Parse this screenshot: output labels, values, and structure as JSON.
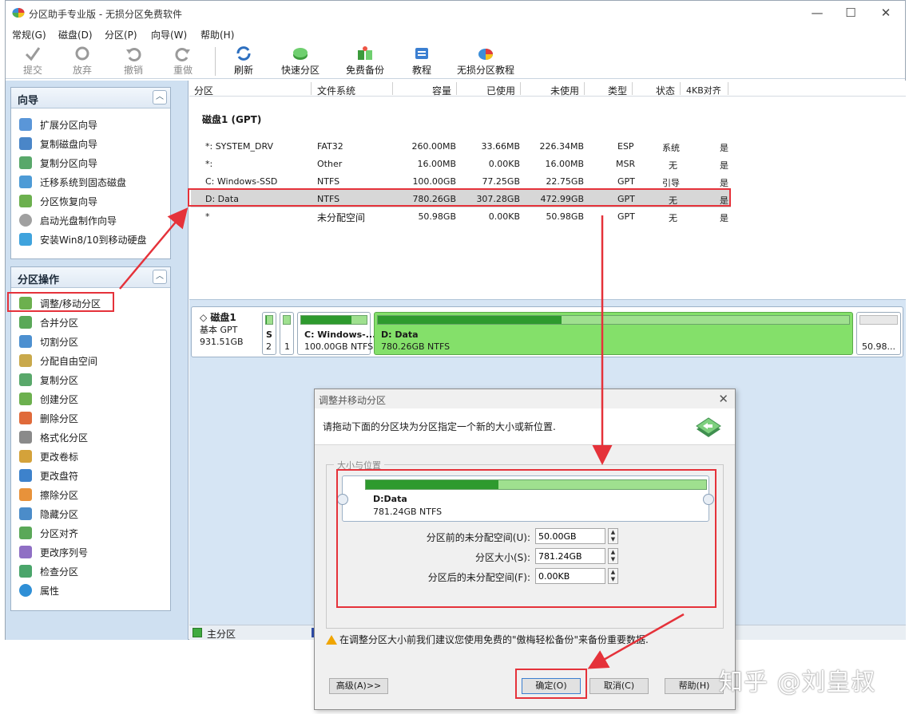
{
  "app": {
    "title": "分区助手专业版 - 无损分区免费软件",
    "min": "—",
    "max": "☐",
    "close": "✕"
  },
  "menu": [
    "常规(G)",
    "磁盘(D)",
    "分区(P)",
    "向导(W)",
    "帮助(H)"
  ],
  "toolbar": [
    {
      "label": "提交",
      "icon": "check-icon",
      "enabled": false
    },
    {
      "label": "放弃",
      "icon": "discard-icon",
      "enabled": false
    },
    {
      "label": "撤销",
      "icon": "undo-icon",
      "enabled": false
    },
    {
      "label": "重做",
      "icon": "redo-icon",
      "enabled": false
    },
    {
      "label": "刷新",
      "icon": "refresh-icon",
      "enabled": true
    },
    {
      "label": "快速分区",
      "icon": "quick-partition-icon",
      "enabled": true
    },
    {
      "label": "免费备份",
      "icon": "backup-icon",
      "enabled": true
    },
    {
      "label": "教程",
      "icon": "tutorial-icon",
      "enabled": true
    },
    {
      "label": "无损分区教程",
      "icon": "lossless-tutorial-icon",
      "enabled": true
    }
  ],
  "wizard_panel": {
    "title": "向导",
    "items": [
      "扩展分区向导",
      "复制磁盘向导",
      "复制分区向导",
      "迁移系统到固态磁盘",
      "分区恢复向导",
      "启动光盘制作向导",
      "安装Win8/10到移动硬盘"
    ]
  },
  "ops_panel": {
    "title": "分区操作",
    "items": [
      "调整/移动分区",
      "合并分区",
      "切割分区",
      "分配自由空间",
      "复制分区",
      "创建分区",
      "删除分区",
      "格式化分区",
      "更改卷标",
      "更改盘符",
      "擦除分区",
      "隐藏分区",
      "分区对齐",
      "更改序列号",
      "检查分区",
      "属性"
    ]
  },
  "table": {
    "headers": [
      "分区",
      "文件系统",
      "容量",
      "已使用",
      "未使用",
      "类型",
      "状态",
      "4KB对齐"
    ],
    "disk_label": "磁盘1 (GPT)",
    "rows": [
      [
        "*: SYSTEM_DRV",
        "FAT32",
        "260.00MB",
        "33.66MB",
        "226.34MB",
        "ESP",
        "系统",
        "是"
      ],
      [
        "*:",
        "Other",
        "16.00MB",
        "0.00KB",
        "16.00MB",
        "MSR",
        "无",
        "是"
      ],
      [
        "C: Windows-SSD",
        "NTFS",
        "100.00GB",
        "77.25GB",
        "22.75GB",
        "GPT",
        "引导",
        "是"
      ],
      [
        "D: Data",
        "NTFS",
        "780.26GB",
        "307.28GB",
        "472.99GB",
        "GPT",
        "无",
        "是"
      ],
      [
        "*",
        "未分配空间",
        "50.98GB",
        "0.00KB",
        "50.98GB",
        "GPT",
        "无",
        "是"
      ]
    ],
    "selected_row": 3
  },
  "disk_map": {
    "name": "磁盘1",
    "style": "基本 GPT",
    "size": "931.51GB",
    "parts": [
      {
        "name": "S",
        "info": "2",
        "used": 0.13
      },
      {
        "name": "",
        "info": "1",
        "used": 0.0
      },
      {
        "name": "C: Windows-...",
        "info": "100.00GB NTFS",
        "used": 0.77
      },
      {
        "name": "D: Data",
        "info": "780.26GB NTFS",
        "used": 0.39
      },
      {
        "name": "",
        "info": "50.98...",
        "used": 0.0
      }
    ]
  },
  "legend": {
    "primary": "主分区"
  },
  "dialog": {
    "title": "调整并移动分区",
    "close": "✕",
    "message": "请拖动下面的分区块为分区指定一个新的大小或新位置.",
    "group_label": "大小与位置",
    "partition_name": "D:Data",
    "partition_info": "781.24GB NTFS",
    "used": 0.39,
    "fields": [
      {
        "label": "分区前的未分配空间(U):",
        "value": "50.00GB"
      },
      {
        "label": "分区大小(S):",
        "value": "781.24GB"
      },
      {
        "label": "分区后的未分配空间(F):",
        "value": "0.00KB"
      }
    ],
    "warning": "在调整分区大小前我们建议您使用免费的\"傲梅轻松备份\"来备份重要数据.",
    "buttons": {
      "advanced": "高级(A)>>",
      "ok": "确定(O)",
      "cancel": "取消(C)",
      "help": "帮助(H)"
    }
  },
  "watermark": "知乎 @刘皇叔",
  "colors": {
    "accent": "#e5323a",
    "bar_used": "#2e9a2e",
    "bar_free": "#9fe08f",
    "selected_part": "#84e06a"
  }
}
